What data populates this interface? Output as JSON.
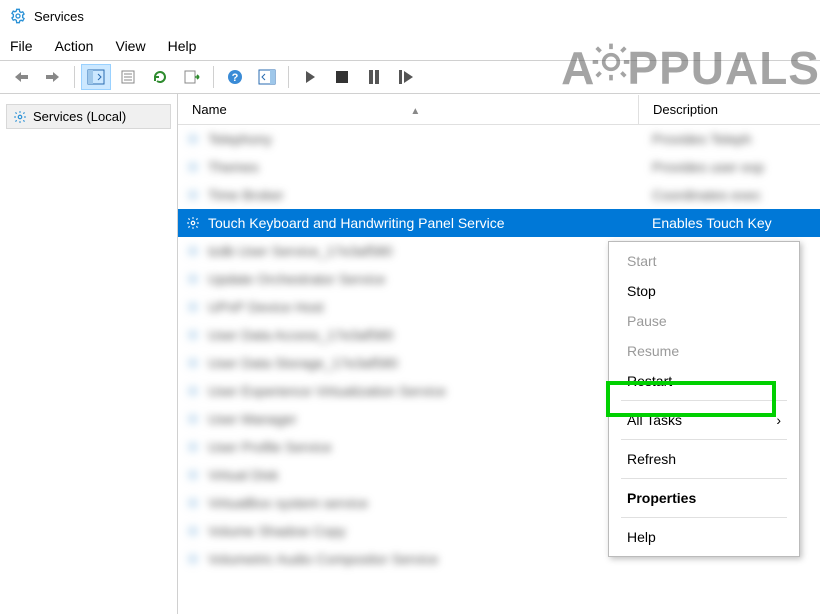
{
  "window": {
    "title": "Services"
  },
  "menu": {
    "file": "File",
    "action": "Action",
    "view": "View",
    "help": "Help"
  },
  "tree": {
    "root": "Services (Local)"
  },
  "columns": {
    "name": "Name",
    "description": "Description"
  },
  "selected": {
    "name": "Touch Keyboard and Handwriting Panel Service",
    "description": "Enables Touch Key"
  },
  "blurred_rows": [
    {
      "name": "Telephony",
      "desc": "Provides Teleph"
    },
    {
      "name": "Themes",
      "desc": "Provides user exp"
    },
    {
      "name": "Time Broker",
      "desc": "Coordinates exec"
    },
    {
      "name": "tzdb User Service_17e3af580",
      "desc": ""
    },
    {
      "name": "Update Orchestrator Service",
      "desc": ""
    },
    {
      "name": "UPnP Device Host",
      "desc": ""
    },
    {
      "name": "User Data Access_17e3af580",
      "desc": ""
    },
    {
      "name": "User Data Storage_17e3af580",
      "desc": ""
    },
    {
      "name": "User Experience Virtualization Service",
      "desc": ""
    },
    {
      "name": "User Manager",
      "desc": ""
    },
    {
      "name": "User Profile Service",
      "desc": ""
    },
    {
      "name": "Virtual Disk",
      "desc": ""
    },
    {
      "name": "VirtualBox system service",
      "desc": ""
    },
    {
      "name": "Volume Shadow Copy",
      "desc": ""
    },
    {
      "name": "Volumetric Audio Compositor Service",
      "desc": ""
    }
  ],
  "context_menu": {
    "start": "Start",
    "stop": "Stop",
    "pause": "Pause",
    "resume": "Resume",
    "restart": "Restart",
    "all_tasks": "All Tasks",
    "refresh": "Refresh",
    "properties": "Properties",
    "help": "Help"
  },
  "watermark": {
    "a": "A",
    "ppuals": "PPUALS"
  }
}
